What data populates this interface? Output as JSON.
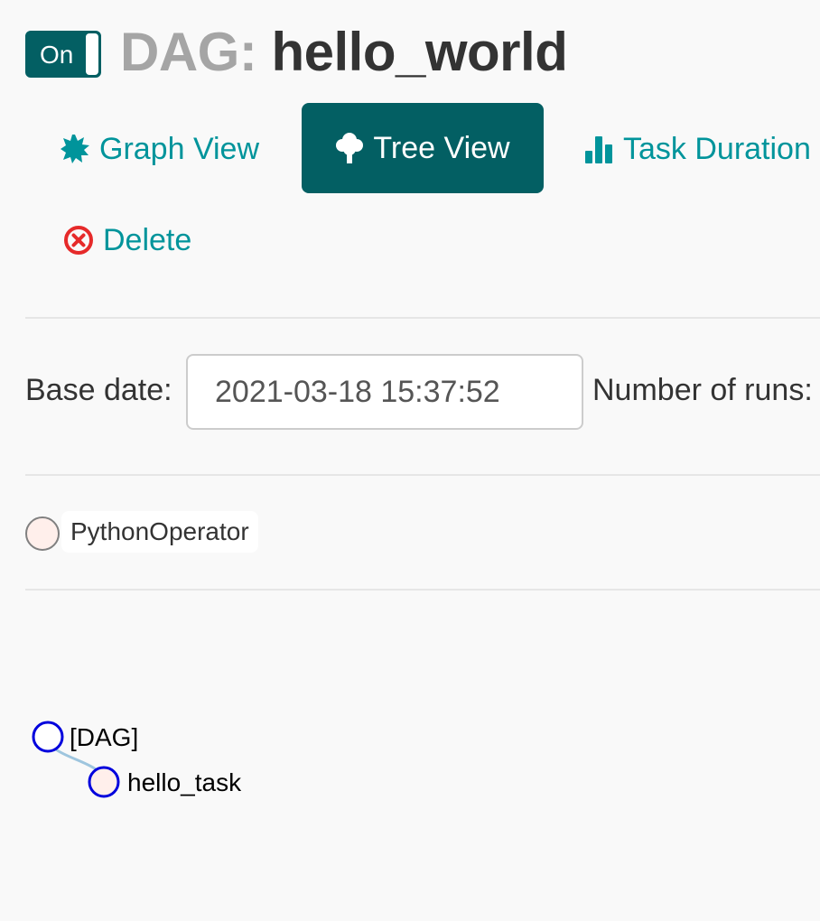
{
  "header": {
    "toggle_label": "On",
    "title_prefix": "DAG:",
    "dag_id": "hello_world"
  },
  "nav": {
    "graph_view": "Graph View",
    "tree_view": "Tree View",
    "task_duration": "Task Duration",
    "delete": "Delete"
  },
  "form": {
    "base_date_label": "Base date:",
    "base_date_value": "2021-03-18 15:37:52",
    "num_runs_label": "Number of runs:"
  },
  "legend": {
    "operator": "PythonOperator",
    "operator_color": "#ffefeb"
  },
  "tree": {
    "root_label": "[DAG]",
    "task_label": "hello_task",
    "node_stroke": "#0000dd",
    "link_color": "#9ec5de"
  },
  "colors": {
    "accent": "#035f63",
    "link": "#00949b",
    "danger": "#e62a2a"
  },
  "icons": {
    "graph": "sunburst-icon",
    "tree": "tree-icon",
    "duration": "bar-chart-icon",
    "delete": "remove-circle-icon"
  }
}
